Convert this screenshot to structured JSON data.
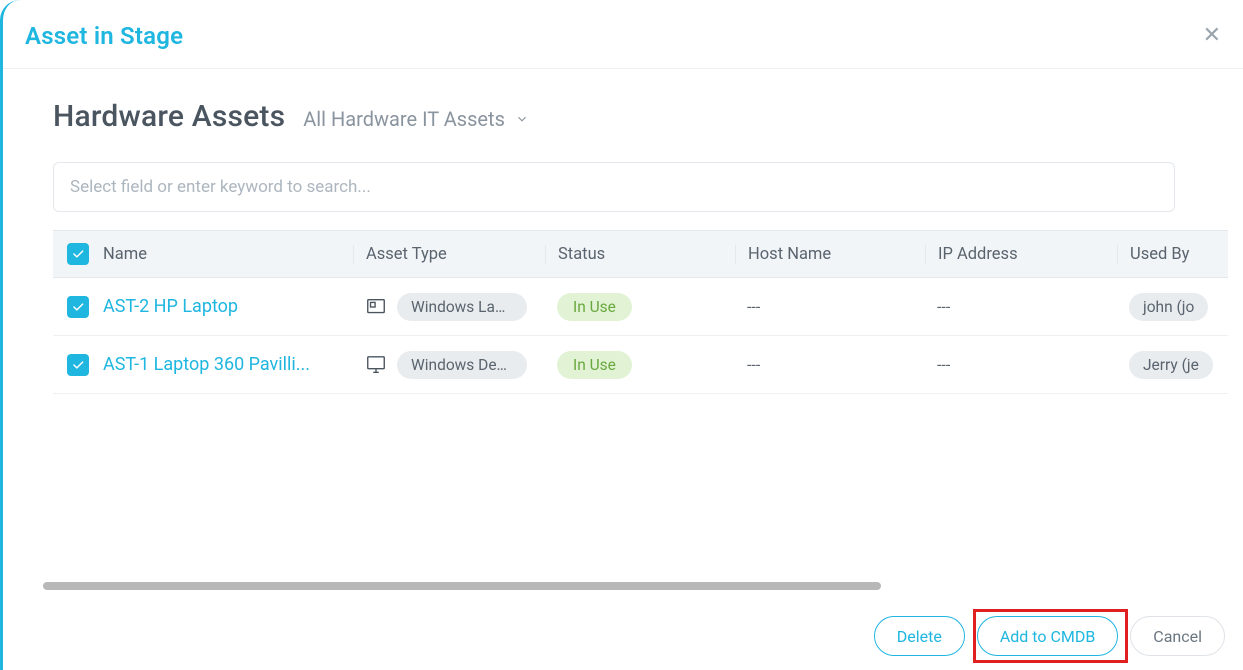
{
  "header": {
    "title": "Asset in Stage"
  },
  "page_title": "Hardware Assets",
  "subtitle": "All Hardware IT Assets",
  "search": {
    "placeholder": "Select field or enter keyword to search..."
  },
  "columns": {
    "name": "Name",
    "asset_type": "Asset Type",
    "status": "Status",
    "host_name": "Host Name",
    "ip_address": "IP Address",
    "used_by": "Used By"
  },
  "rows": [
    {
      "checked": true,
      "name": "AST-2 HP Laptop",
      "asset_type": "Windows Lap...",
      "type_icon": "laptop",
      "status": "In Use",
      "host_name": "---",
      "ip_address": "---",
      "used_by": "john (jo"
    },
    {
      "checked": true,
      "name": "AST-1 Laptop 360 Pavilli...",
      "asset_type": "Windows Des...",
      "type_icon": "desktop",
      "status": "In Use",
      "host_name": "---",
      "ip_address": "---",
      "used_by": "Jerry (je"
    }
  ],
  "footer": {
    "delete": "Delete",
    "add_to_cmdb": "Add to CMDB",
    "cancel": "Cancel"
  },
  "highlight": {
    "target": "add-to-cmdb-button"
  }
}
